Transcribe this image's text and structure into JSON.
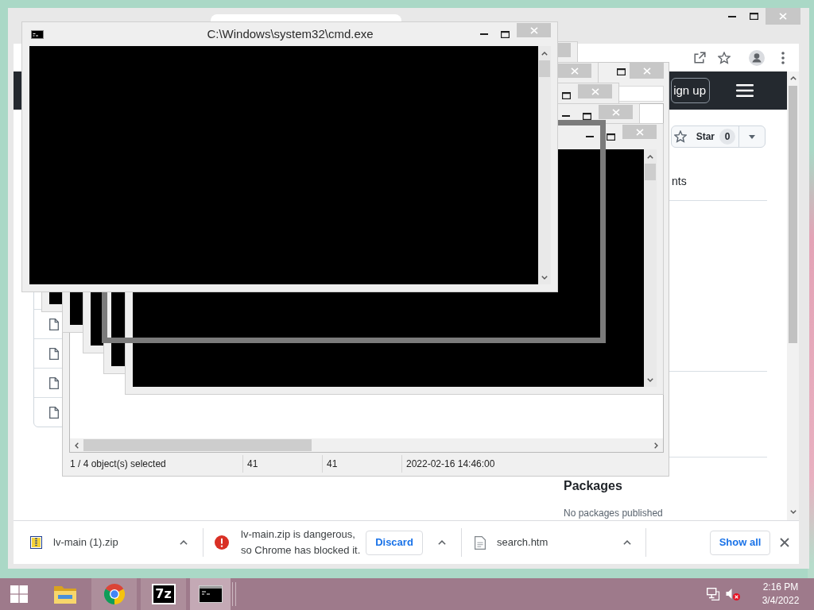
{
  "console_window": {
    "title": "C:\\Windows\\system32\\cmd.exe"
  },
  "browser": {
    "page": {
      "header": {
        "signup_label": "ign up"
      },
      "star": {
        "label": "Star",
        "count": "0"
      },
      "fragment": "nts",
      "files": [
        {
          "kind": "file"
        },
        {
          "kind": "file"
        },
        {
          "kind": "file"
        },
        {
          "kind": "file"
        }
      ],
      "packages": {
        "heading": "Packages",
        "note": "No packages published"
      }
    },
    "downloads": {
      "items": [
        {
          "kind": "archive",
          "name": "lv-main (1).zip"
        },
        {
          "kind": "blocked",
          "message": [
            "lv-main.zip is dangerous,",
            "so Chrome has blocked it."
          ],
          "action": "Discard"
        },
        {
          "kind": "document",
          "name": "search.htm"
        }
      ],
      "show_all": "Show all"
    }
  },
  "archive_window": {
    "status_bar": [
      "1 / 4 object(s) selected",
      "41",
      "41",
      "2022-02-16 14:46:00"
    ]
  },
  "taskbar": {
    "apps": [
      {
        "kind": "files",
        "running": false,
        "selected": false
      },
      {
        "kind": "browser",
        "running": true,
        "selected": false
      },
      {
        "kind": "archiver",
        "label": "7z",
        "running": true,
        "selected": false
      },
      {
        "kind": "console",
        "running": true,
        "selected": true
      }
    ],
    "clock": {
      "time": "2:16 PM",
      "date": "3/4/2022"
    }
  }
}
